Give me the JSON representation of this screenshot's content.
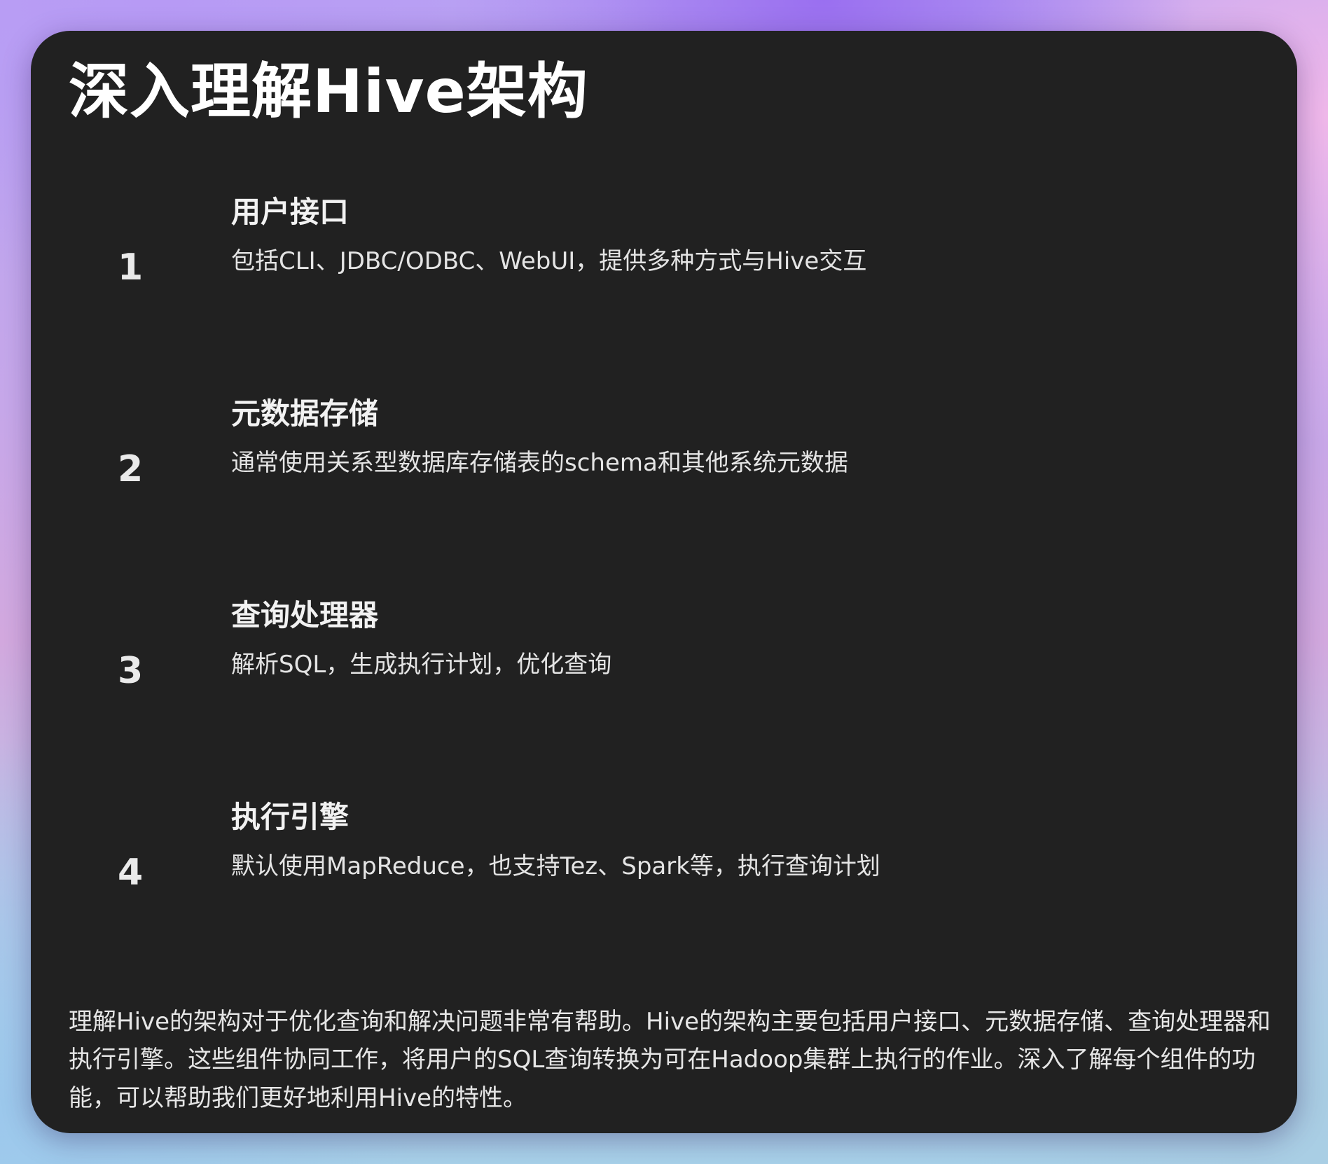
{
  "title": "深入理解Hive架构",
  "items": [
    {
      "number": "1",
      "heading": "用户接口",
      "description": "包括CLI、JDBC/ODBC、WebUI，提供多种方式与Hive交互"
    },
    {
      "number": "2",
      "heading": "元数据存储",
      "description": "通常使用关系型数据库存储表的schema和其他系统元数据"
    },
    {
      "number": "3",
      "heading": "查询处理器",
      "description": "解析SQL，生成执行计划，优化查询"
    },
    {
      "number": "4",
      "heading": "执行引擎",
      "description": "默认使用MapReduce，也支持Tez、Spark等，执行查询计划"
    }
  ],
  "summary": " 理解Hive的架构对于优化查询和解决问题非常有帮助。Hive的架构主要包括用户接口、元数据存储、查询处理器和执行引擎。这些组件协同工作，将用户的SQL查询转换为可在Hadoop集群上执行的作业。深入了解每个组件的功能，可以帮助我们更好地利用Hive的特性。"
}
